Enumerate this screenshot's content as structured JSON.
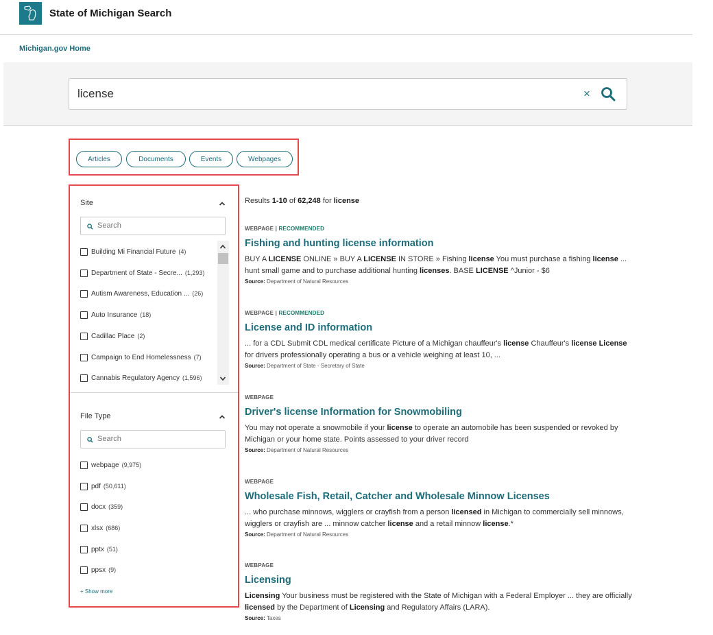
{
  "header": {
    "title": "State of Michigan Search",
    "logo_icon": "michigan-state-outline-icon"
  },
  "nav": {
    "home_link": "Michigan.gov Home"
  },
  "search": {
    "query": "license",
    "clear_label": "×"
  },
  "content_types": [
    "Articles",
    "Documents",
    "Events",
    "Webpages"
  ],
  "filters": {
    "site": {
      "title": "Site",
      "search_placeholder": "Search",
      "items": [
        {
          "label": "Building Mi Financial Future",
          "count": "(4)"
        },
        {
          "label": "Department of State - Secre...",
          "count": "(1,293)"
        },
        {
          "label": "Autism Awareness, Education ...",
          "count": "(26)"
        },
        {
          "label": "Auto Insurance",
          "count": "(18)"
        },
        {
          "label": "Cadillac Place",
          "count": "(2)"
        },
        {
          "label": "Campaign to End Homelessness",
          "count": "(7)"
        },
        {
          "label": "Cannabis Regulatory Agency",
          "count": "(1,596)"
        }
      ]
    },
    "file_type": {
      "title": "File Type",
      "search_placeholder": "Search",
      "items": [
        {
          "label": "webpage",
          "count": "(9,975)"
        },
        {
          "label": "pdf",
          "count": "(50,611)"
        },
        {
          "label": "docx",
          "count": "(359)"
        },
        {
          "label": "xlsx",
          "count": "(686)"
        },
        {
          "label": "pptx",
          "count": "(51)"
        },
        {
          "label": "ppsx",
          "count": "(9)"
        }
      ],
      "show_more": "+ Show more"
    }
  },
  "results": {
    "summary": {
      "prefix": "Results",
      "range": "1-10",
      "of": "of",
      "total": "62,248",
      "for": "for",
      "query": "license"
    },
    "source_label": "Source:",
    "items": [
      {
        "type": "WEBPAGE",
        "recommended": "RECOMMENDED",
        "title": "Fishing and hunting license information",
        "snippet": "BUY A <b>LICENSE</b> ONLINE » BUY A <b>LICENSE</b> IN STORE » Fishing <b>license</b> You must purchase a fishing <b>license</b> ... hunt small game and to purchase additional hunting <b>licenses</b>. BASE <b>LICENSE</b> ^Junior - $6",
        "source": "Department of Natural Resources"
      },
      {
        "type": "WEBPAGE",
        "recommended": "RECOMMENDED",
        "title": "License and ID information",
        "snippet": "... for a CDL Submit CDL medical certificate Picture of a Michigan chauffeur's <b>license</b> Chauffeur's <b>license License</b> for drivers professionally operating a bus or a vehicle weighing at least 10, ...",
        "source": "Department of State - Secretary of State"
      },
      {
        "type": "WEBPAGE",
        "recommended": "",
        "title": "Driver's license Information for Snowmobiling",
        "snippet": "You may not operate a snowmobile if your <b>license</b> to operate an automobile has been suspended or revoked by Michigan or your home state. Points assessed to your driver record",
        "source": "Department of Natural Resources"
      },
      {
        "type": "WEBPAGE",
        "recommended": "",
        "title": "Wholesale Fish, Retail, Catcher and Wholesale Minnow Licenses",
        "snippet": "... who purchase minnows, wigglers or crayfish from a person <b>licensed</b> in Michigan to commercially sell minnows, wigglers or crayfish are ... minnow catcher <b>license</b> and a retail minnow <b>license</b>.*",
        "source": "Department of Natural Resources"
      },
      {
        "type": "WEBPAGE",
        "recommended": "",
        "title": "Licensing",
        "snippet": "<b>Licensing</b> Your business must be registered with the State of Michigan with a Federal Employer ... they are officially <b>licensed</b> by the Department of <b>Licensing</b> and Regulatory Affairs (LARA).",
        "source": "Taxes"
      }
    ]
  }
}
